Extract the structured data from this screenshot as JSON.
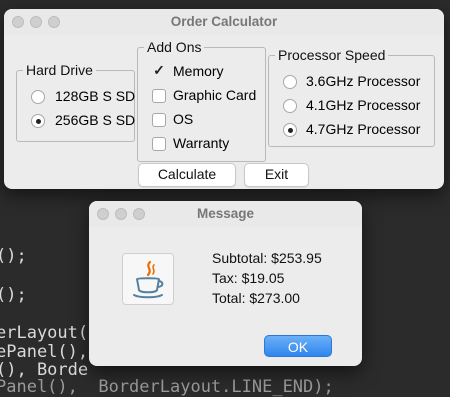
{
  "code_lines": [
    "();",
    "();",
    "erLayout(",
    "ePanel(),",
    "(), Borde",
    "Panel(),  BorderLayout.LINE_END);"
  ],
  "calculator": {
    "title": "Order Calculator",
    "hard_drive": {
      "legend": "Hard Drive",
      "options": [
        {
          "label": "128GB S SD",
          "selected": false
        },
        {
          "label": "256GB S SD",
          "selected": true
        }
      ]
    },
    "add_ons": {
      "legend": "Add Ons",
      "options": [
        {
          "label": "Memory",
          "checked": true
        },
        {
          "label": "Graphic Card",
          "checked": false
        },
        {
          "label": "OS",
          "checked": false
        },
        {
          "label": "Warranty",
          "checked": false
        }
      ]
    },
    "processor": {
      "legend": "Processor Speed",
      "options": [
        {
          "label": "3.6GHz Processor",
          "selected": false
        },
        {
          "label": "4.1GHz Processor",
          "selected": false
        },
        {
          "label": "4.7GHz Processor",
          "selected": true
        }
      ]
    },
    "calculate_label": "Calculate",
    "exit_label": "Exit"
  },
  "message": {
    "title": "Message",
    "subtotal": "Subtotal: $253.95",
    "tax": "Tax: $19.05",
    "total": "Total: $273.00",
    "ok_label": "OK"
  },
  "colors": {
    "ok_button": "#2f86ee",
    "editor_background": "#2b2b2b"
  }
}
